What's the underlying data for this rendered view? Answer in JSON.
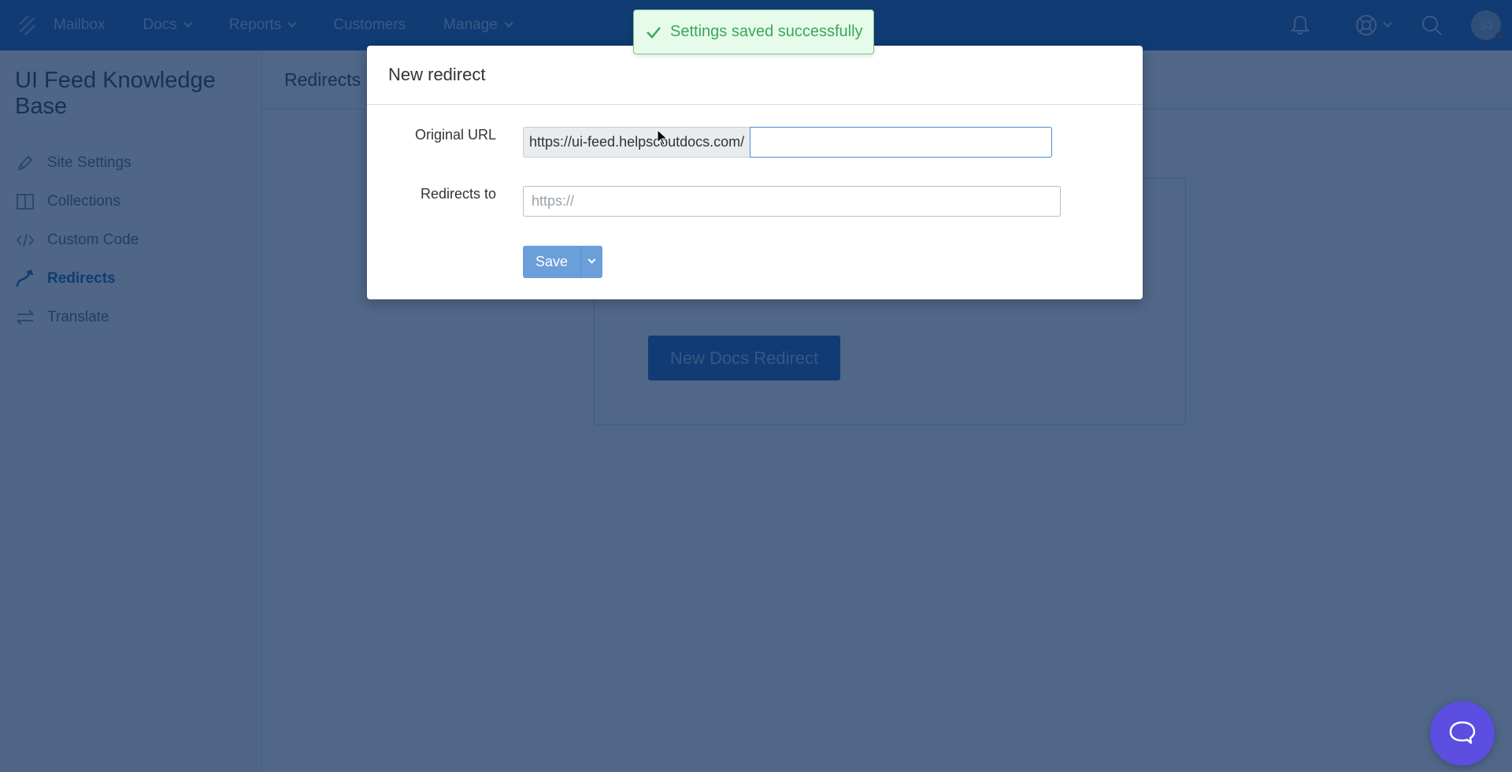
{
  "topnav": {
    "items": [
      {
        "label": "Mailbox",
        "has_dropdown": false
      },
      {
        "label": "Docs",
        "has_dropdown": true
      },
      {
        "label": "Reports",
        "has_dropdown": true
      },
      {
        "label": "Customers",
        "has_dropdown": false
      },
      {
        "label": "Manage",
        "has_dropdown": true
      }
    ],
    "right_icons": [
      "bell-icon",
      "lifebuoy-icon",
      "search-icon"
    ],
    "avatar_initials": "SJ",
    "accent_color": "#1f62b3"
  },
  "sidebar": {
    "title": "UI Feed Knowledge Base",
    "items": [
      {
        "label": "Site Settings",
        "icon": "pencil-icon",
        "active": false
      },
      {
        "label": "Collections",
        "icon": "book-icon",
        "active": false
      },
      {
        "label": "Custom Code",
        "icon": "code-icon",
        "active": false
      },
      {
        "label": "Redirects",
        "icon": "redirect-arrow-icon",
        "active": true
      },
      {
        "label": "Translate",
        "icon": "swap-arrows-icon",
        "active": false
      }
    ]
  },
  "main": {
    "header_title": "Redirects",
    "new_redirect_button": "New Docs Redirect"
  },
  "modal": {
    "title": "New redirect",
    "original_url_label": "Original URL",
    "original_url_prefix": "https://ui-feed.helpscoutdocs.com/",
    "original_url_value": "",
    "redirects_to_label": "Redirects to",
    "redirects_to_placeholder": "https://",
    "redirects_to_value": "",
    "save_label": "Save"
  },
  "toast": {
    "message": "Settings saved successfully",
    "status": "success",
    "color": "#3ba65a"
  },
  "chat": {
    "icon": "chat-bubble-icon",
    "color": "#5b4ee0"
  }
}
